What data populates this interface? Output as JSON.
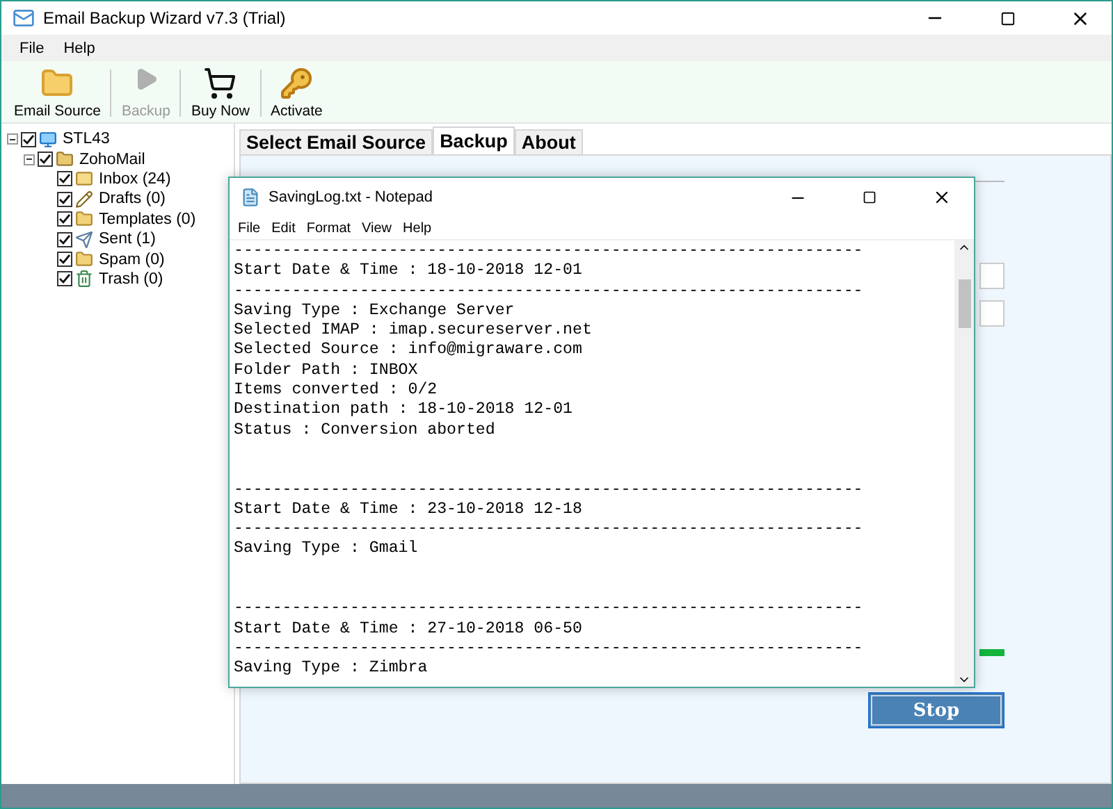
{
  "window": {
    "title": "Email Backup Wizard v7.3 (Trial)"
  },
  "menu": [
    "File",
    "Help"
  ],
  "toolbar": [
    {
      "kind": "source",
      "label": "Email Source",
      "disabled": false
    },
    {
      "kind": "backup",
      "label": "Backup",
      "disabled": true
    },
    {
      "kind": "buy",
      "label": "Buy Now",
      "disabled": false
    },
    {
      "kind": "activate",
      "label": "Activate",
      "disabled": false
    }
  ],
  "tree": [
    {
      "kind": "computer",
      "label": "STL43",
      "checked": true,
      "expanded": true,
      "children": [
        {
          "kind": "account",
          "label": "ZohoMail",
          "checked": true,
          "expanded": true,
          "children": [
            {
              "kind": "inbox",
              "label": "Inbox (24)",
              "checked": true
            },
            {
              "kind": "drafts",
              "label": "Drafts (0)",
              "checked": true
            },
            {
              "kind": "folder",
              "label": "Templates (0)",
              "checked": true
            },
            {
              "kind": "sent",
              "label": "Sent (1)",
              "checked": true
            },
            {
              "kind": "folder",
              "label": "Spam (0)",
              "checked": true
            },
            {
              "kind": "trash",
              "label": "Trash (0)",
              "checked": true
            }
          ]
        }
      ]
    }
  ],
  "tabs": [
    {
      "label": "Select Email Source",
      "selected": false
    },
    {
      "label": "Backup",
      "selected": true
    },
    {
      "label": "About",
      "selected": false
    }
  ],
  "progress": {
    "level": 1
  },
  "stop_button": "Stop",
  "notepad": {
    "title": "SavingLog.txt - Notepad",
    "menu": [
      "File",
      "Edit",
      "Format",
      "View",
      "Help"
    ],
    "blocks": [
      {
        "lines": [
          "-----------------------------------------------------------------",
          "Start Date & Time : 18-10-2018 12-01",
          "-----------------------------------------------------------------",
          "Saving Type : Exchange Server",
          "Selected IMAP : imap.secureserver.net",
          "Selected Source : info@migraware.com",
          "Folder Path : INBOX",
          "Items converted : 0/2",
          "Destination path : 18-10-2018 12-01",
          "Status : Conversion aborted"
        ]
      },
      {
        "lines": [
          "-----------------------------------------------------------------",
          "Start Date & Time : 23-10-2018 12-18",
          "-----------------------------------------------------------------",
          "Saving Type : Gmail"
        ]
      },
      {
        "lines": [
          "-----------------------------------------------------------------",
          "Start Date & Time : 27-10-2018 06-50",
          "-----------------------------------------------------------------",
          "Saving Type : Zimbra"
        ]
      }
    ]
  }
}
